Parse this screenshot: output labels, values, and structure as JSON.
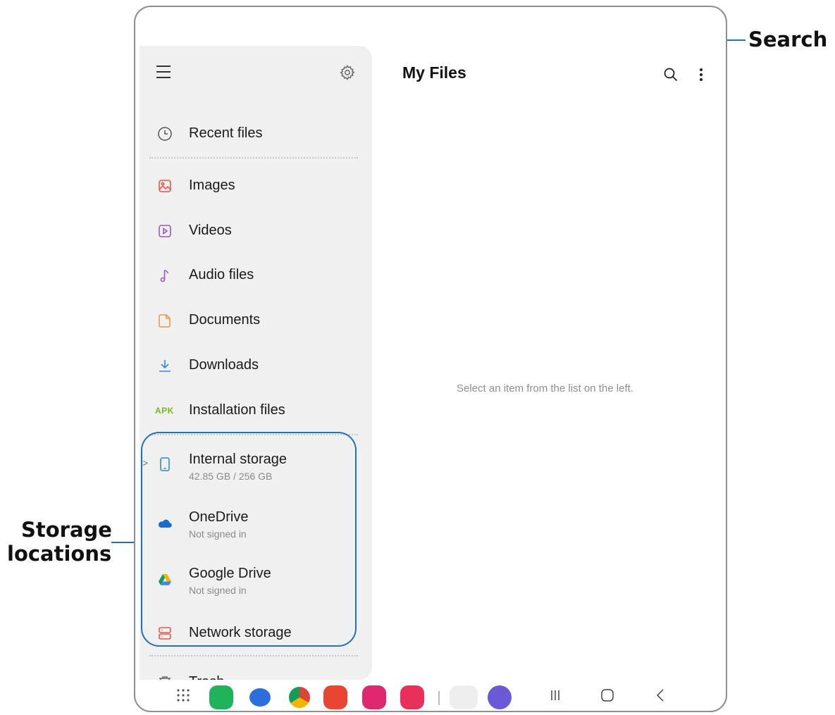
{
  "header": {
    "title": "My Files"
  },
  "sidebar": {
    "items": [
      {
        "label": "Recent files",
        "icon": "clock-icon"
      },
      {
        "label": "Images",
        "icon": "image-icon"
      },
      {
        "label": "Videos",
        "icon": "video-icon"
      },
      {
        "label": "Audio files",
        "icon": "music-note-icon"
      },
      {
        "label": "Documents",
        "icon": "document-icon"
      },
      {
        "label": "Downloads",
        "icon": "download-icon"
      },
      {
        "label": "Installation files",
        "icon": "apk-icon",
        "badge": "APK"
      }
    ],
    "storage": [
      {
        "label": "Internal storage",
        "sub": "42.85 GB / 256 GB",
        "icon": "phone-icon"
      },
      {
        "label": "OneDrive",
        "sub": "Not signed in",
        "icon": "onedrive-icon"
      },
      {
        "label": "Google Drive",
        "sub": "Not signed in",
        "icon": "google-drive-icon"
      },
      {
        "label": "Network storage",
        "icon": "network-storage-icon"
      }
    ],
    "trash": {
      "label": "Trash"
    }
  },
  "main": {
    "empty_message": "Select an item from the list on the left."
  },
  "callouts": {
    "search": "Search",
    "storage_line1": "Storage",
    "storage_line2": "locations"
  },
  "colors": {
    "accent": "#1f74b8",
    "sidebar_bg": "#f0f0f0"
  }
}
